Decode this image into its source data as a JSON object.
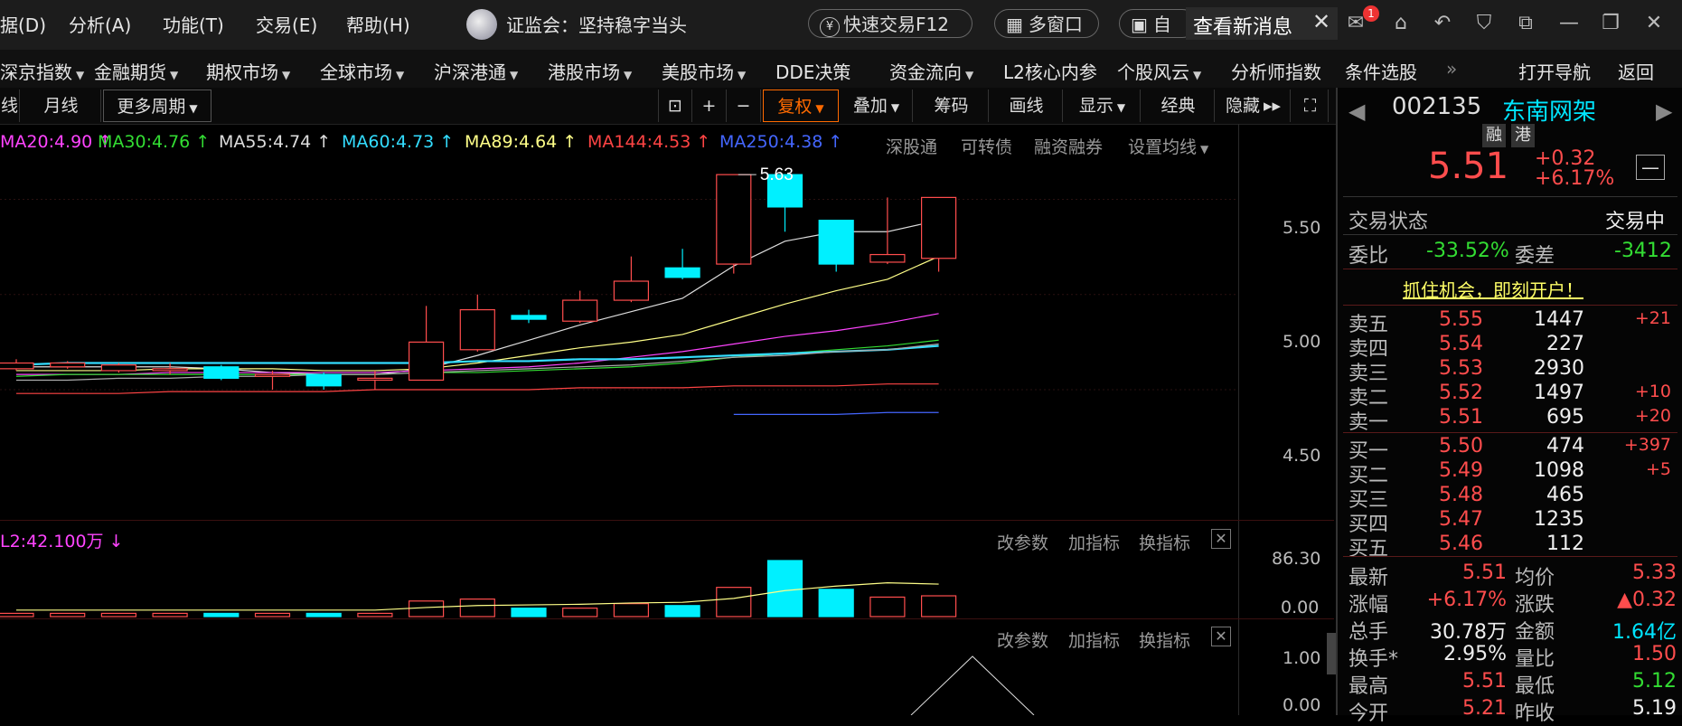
{
  "menu": {
    "items": [
      "据(D)",
      "分析(A)",
      "功能(T)",
      "交易(E)",
      "帮助(H)"
    ],
    "news_ticker": "证监会：坚持稳字当头",
    "quick_trade": "快速交易F12",
    "multi_window": "多窗口",
    "self_select": "自选",
    "new_message": "查看新消息",
    "mail_badge": "1"
  },
  "nav": {
    "items": [
      "深京指数",
      "金融期货",
      "期权市场",
      "全球市场",
      "沪深港通",
      "港股市场",
      "美股市场",
      "DDE决策",
      "资金流向",
      "L2核心内参",
      "个股风云",
      "分析师指数",
      "条件选股"
    ],
    "more": "»",
    "open_nav": "打开导航",
    "back": "返回"
  },
  "toolbar": {
    "period_partial": "线",
    "monthly": "月线",
    "more_periods": "更多周期",
    "plus": "+",
    "minus": "−",
    "fuquan": "复权",
    "overlay": "叠加",
    "chips": "筹码",
    "draw": "画线",
    "display": "显示",
    "classic": "经典",
    "hide": "隐藏"
  },
  "ma_legend": [
    {
      "label": "MA20:4.90",
      "arrow": "↑",
      "color": "#ff44ff"
    },
    {
      "label": "MA30:4.76",
      "arrow": "↑",
      "color": "#33dd33"
    },
    {
      "label": "MA55:4.74",
      "arrow": "↑",
      "color": "#dddddd"
    },
    {
      "label": "MA60:4.73",
      "arrow": "↑",
      "color": "#33ddff"
    },
    {
      "label": "MA89:4.64",
      "arrow": "↑",
      "color": "#ffff88"
    },
    {
      "label": "MA144:4.53",
      "arrow": "↑",
      "color": "#ff4444"
    },
    {
      "label": "MA250:4.38",
      "arrow": "↑",
      "color": "#4466ff"
    }
  ],
  "chart_links": [
    "深股通",
    "可转债",
    "融资融券",
    "设置均线"
  ],
  "price_axis": [
    "5.50",
    "5.00",
    "4.50"
  ],
  "max_label": "5.63",
  "sub1": {
    "label": "L2:42.100万",
    "arrow": "↓",
    "controls": [
      "改参数",
      "加指标",
      "换指标"
    ],
    "axis": [
      "86.30",
      "0.00"
    ]
  },
  "sub2": {
    "controls": [
      "改参数",
      "加指标",
      "换指标"
    ],
    "axis": [
      "1.00",
      "0.00"
    ]
  },
  "chart_data": {
    "type": "candlestick",
    "candles": [
      {
        "o": 4.61,
        "c": 4.64,
        "h": 4.66,
        "l": 4.6
      },
      {
        "o": 4.62,
        "c": 4.64,
        "h": 4.65,
        "l": 4.61
      },
      {
        "o": 4.6,
        "c": 4.63,
        "h": 4.64,
        "l": 4.59
      },
      {
        "o": 4.6,
        "c": 4.61,
        "h": 4.64,
        "l": 4.58
      },
      {
        "o": 4.62,
        "c": 4.56,
        "h": 4.63,
        "l": 4.55
      },
      {
        "o": 4.57,
        "c": 4.58,
        "h": 4.6,
        "l": 4.5
      },
      {
        "o": 4.58,
        "c": 4.52,
        "h": 4.59,
        "l": 4.5
      },
      {
        "o": 4.55,
        "c": 4.56,
        "h": 4.6,
        "l": 4.5
      },
      {
        "o": 4.55,
        "c": 4.75,
        "h": 4.94,
        "l": 4.55
      },
      {
        "o": 4.71,
        "c": 4.92,
        "h": 5.0,
        "l": 4.7
      },
      {
        "o": 4.89,
        "c": 4.87,
        "h": 4.92,
        "l": 4.85
      },
      {
        "o": 4.86,
        "c": 4.97,
        "h": 5.02,
        "l": 4.85
      },
      {
        "o": 4.97,
        "c": 5.07,
        "h": 5.2,
        "l": 4.96
      },
      {
        "o": 5.14,
        "c": 5.09,
        "h": 5.24,
        "l": 5.08
      },
      {
        "o": 5.16,
        "c": 5.63,
        "h": 5.63,
        "l": 5.11
      },
      {
        "o": 5.63,
        "c": 5.46,
        "h": 5.63,
        "l": 5.33
      },
      {
        "o": 5.39,
        "c": 5.16,
        "h": 5.39,
        "l": 5.12
      },
      {
        "o": 5.17,
        "c": 5.21,
        "h": 5.51,
        "l": 5.16
      },
      {
        "o": 5.19,
        "c": 5.51,
        "h": 5.51,
        "l": 5.12
      }
    ],
    "ma_lines": [
      {
        "name": "MA5",
        "color": "#dddddd",
        "values": [
          4.62,
          4.62,
          4.62,
          4.62,
          4.61,
          4.59,
          4.58,
          4.58,
          4.61,
          4.68,
          4.76,
          4.84,
          4.91,
          4.98,
          5.15,
          5.28,
          5.33,
          5.33,
          5.39
        ]
      },
      {
        "name": "MA10",
        "color": "#ffff88",
        "values": [
          4.6,
          4.6,
          4.6,
          4.61,
          4.61,
          4.61,
          4.6,
          4.6,
          4.61,
          4.64,
          4.68,
          4.72,
          4.75,
          4.79,
          4.87,
          4.95,
          5.02,
          5.08,
          5.2
        ]
      },
      {
        "name": "MA20",
        "color": "#ff44ff",
        "values": [
          4.58,
          4.58,
          4.58,
          4.59,
          4.59,
          4.59,
          4.59,
          4.59,
          4.6,
          4.61,
          4.62,
          4.64,
          4.67,
          4.7,
          4.74,
          4.78,
          4.81,
          4.85,
          4.9
        ]
      },
      {
        "name": "MA30",
        "color": "#33dd33",
        "values": [
          4.57,
          4.58,
          4.58,
          4.58,
          4.58,
          4.58,
          4.58,
          4.58,
          4.59,
          4.59,
          4.6,
          4.61,
          4.62,
          4.64,
          4.67,
          4.69,
          4.71,
          4.73,
          4.76
        ]
      },
      {
        "name": "MA60",
        "color": "#33ddff",
        "values": [
          4.63,
          4.64,
          4.64,
          4.64,
          4.64,
          4.64,
          4.64,
          4.64,
          4.64,
          4.65,
          4.65,
          4.66,
          4.66,
          4.67,
          4.68,
          4.69,
          4.7,
          4.71,
          4.73
        ]
      },
      {
        "name": "MA55",
        "color": "#aaaaaa",
        "values": [
          4.55,
          4.55,
          4.56,
          4.56,
          4.57,
          4.57,
          4.58,
          4.58,
          4.59,
          4.6,
          4.61,
          4.62,
          4.63,
          4.65,
          4.67,
          4.68,
          4.7,
          4.71,
          4.74
        ]
      },
      {
        "name": "MA144",
        "color": "#ff4444",
        "values": [
          4.48,
          4.48,
          4.48,
          4.49,
          4.49,
          4.49,
          4.49,
          4.5,
          4.5,
          4.5,
          4.5,
          4.51,
          4.51,
          4.51,
          4.52,
          4.52,
          4.52,
          4.53,
          4.53
        ]
      },
      {
        "name": "MA250",
        "color": "#4466ff",
        "values": [
          null,
          null,
          null,
          null,
          null,
          null,
          null,
          null,
          null,
          null,
          null,
          null,
          null,
          null,
          4.37,
          4.37,
          4.37,
          4.38,
          4.38
        ]
      }
    ],
    "volume": [
      5,
      5,
      5,
      5,
      5,
      5,
      5,
      5,
      24,
      27,
      13,
      13,
      20,
      17,
      45,
      86.3,
      42,
      30,
      32
    ],
    "vol_ma": [
      10,
      10,
      10,
      10,
      10,
      10,
      10,
      10,
      14,
      17,
      18,
      19,
      21,
      22,
      28,
      40,
      47,
      52,
      50
    ]
  },
  "stock": {
    "code": "002135",
    "name": "东南网架",
    "tags": [
      "融",
      "港"
    ],
    "price": "5.51",
    "change": "+0.32",
    "change_pct": "+6.17%",
    "status_label": "交易状态",
    "status_value": "交易中",
    "wb_label": "委比",
    "wb_value": "-33.52%",
    "wc_label": "委差",
    "wc_value": "-3412",
    "promo": "抓住机会，即刻开户！"
  },
  "order_book": {
    "asks": [
      {
        "label": "卖五",
        "price": "5.55",
        "vol": "1447",
        "delta": "+21"
      },
      {
        "label": "卖四",
        "price": "5.54",
        "vol": "227",
        "delta": ""
      },
      {
        "label": "卖三",
        "price": "5.53",
        "vol": "2930",
        "delta": ""
      },
      {
        "label": "卖二",
        "price": "5.52",
        "vol": "1497",
        "delta": "+10"
      },
      {
        "label": "卖一",
        "price": "5.51",
        "vol": "695",
        "delta": "+20"
      }
    ],
    "bids": [
      {
        "label": "买一",
        "price": "5.50",
        "vol": "474",
        "delta": "+397"
      },
      {
        "label": "买二",
        "price": "5.49",
        "vol": "1098",
        "delta": "+5"
      },
      {
        "label": "买三",
        "price": "5.48",
        "vol": "465",
        "delta": ""
      },
      {
        "label": "买四",
        "price": "5.47",
        "vol": "1235",
        "delta": ""
      },
      {
        "label": "买五",
        "price": "5.46",
        "vol": "112",
        "delta": ""
      }
    ]
  },
  "quote_stats": [
    {
      "l1": "最新",
      "v1": "5.51",
      "c1": "red",
      "l2": "均价",
      "v2": "5.33",
      "c2": "red"
    },
    {
      "l1": "涨幅",
      "v1": "+6.17%",
      "c1": "red",
      "l2": "涨跌",
      "v2": "▲0.32",
      "c2": "red"
    },
    {
      "l1": "总手",
      "v1": "30.78万",
      "c1": "white",
      "l2": "金额",
      "v2": "1.64亿",
      "c2": "cyan"
    },
    {
      "l1": "换手*",
      "v1": "2.95%",
      "c1": "white",
      "l2": "量比",
      "v2": "1.50",
      "c2": "red"
    },
    {
      "l1": "最高",
      "v1": "5.51",
      "c1": "red",
      "l2": "最低",
      "v2": "5.12",
      "c2": "green"
    },
    {
      "l1": "今开",
      "v1": "5.21",
      "c1": "red",
      "l2": "昨收",
      "v2": "5.19",
      "c2": "white"
    }
  ]
}
